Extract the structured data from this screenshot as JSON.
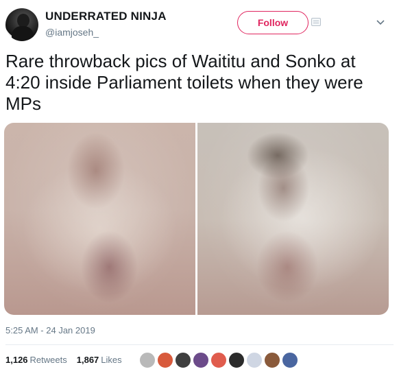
{
  "author": {
    "display_name": "UNDERRATED NINJA",
    "handle": "@iamjoseh_",
    "avatar_icon": "avatar-icon"
  },
  "follow_label": "Follow",
  "tweet_text": "Rare throwback pics of Waititu and Sonko at 4:20 inside Parliament toilets when they were MPs",
  "media": [
    "photo-left",
    "photo-right"
  ],
  "timestamp": "5:25 AM - 24 Jan 2019",
  "stats": {
    "retweets_count": "1,126",
    "retweets_label": "Retweets",
    "likes_count": "1,867",
    "likes_label": "Likes"
  },
  "likers": [
    "#b9b9b9",
    "#d85a3c",
    "#3f3f3f",
    "#6c4b8a",
    "#e05c4d",
    "#2b2b2b",
    "#cfd6e3",
    "#8a5a3b",
    "#4a66a0"
  ],
  "colors": {
    "follow": "#e0245e",
    "muted": "#657786",
    "text": "#14171a"
  }
}
